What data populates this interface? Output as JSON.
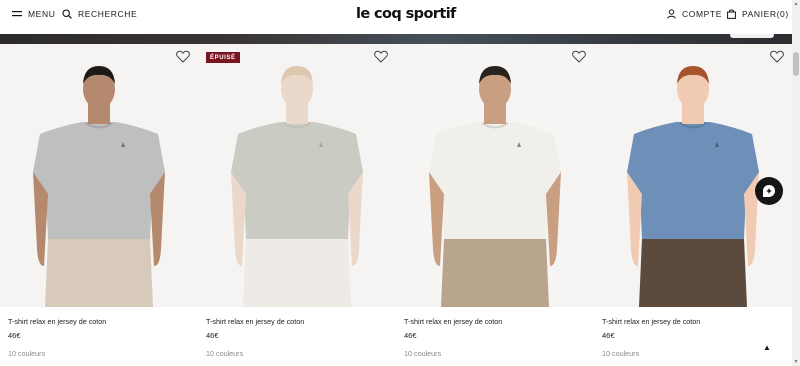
{
  "header": {
    "menu_label": "MENU",
    "search_label": "RECHERCHE",
    "logo_text": "le coq sportif",
    "account_label": "COMPTE",
    "cart_label": "PANIER(0)"
  },
  "products": [
    {
      "name": "T-shirt relax en jersey de coton",
      "price": "46€",
      "colors": "10 couleurs",
      "shirt_color": "#bfbfbf",
      "pants_color": "#d7cabb",
      "badge": ""
    },
    {
      "name": "T-shirt relax en jersey de coton",
      "price": "46€",
      "colors": "10 couleurs",
      "shirt_color": "#a7ab9d",
      "pants_color": "#e9e5de",
      "badge": "ÉPUISÉ"
    },
    {
      "name": "T-shirt relax en jersey de coton",
      "price": "46€",
      "colors": "10 couleurs",
      "shirt_color": "#f1efe9",
      "pants_color": "#b9a58d",
      "badge": ""
    },
    {
      "name": "T-shirt relax en jersey de coton",
      "price": "46€",
      "colors": "10 couleurs",
      "shirt_color": "#6d8fb8",
      "pants_color": "#5c4a3c",
      "badge": ""
    }
  ],
  "icons": {
    "menu": "hamburger-icon",
    "search": "search-icon",
    "account": "user-icon",
    "cart": "bag-icon",
    "favorite": "heart-icon",
    "chat": "chat-icon",
    "back_to_top": "arrow-up-icon"
  },
  "colors": {
    "badge_bg": "#7a1420",
    "text": "#1a1a1a",
    "muted": "#8a8a8a"
  }
}
